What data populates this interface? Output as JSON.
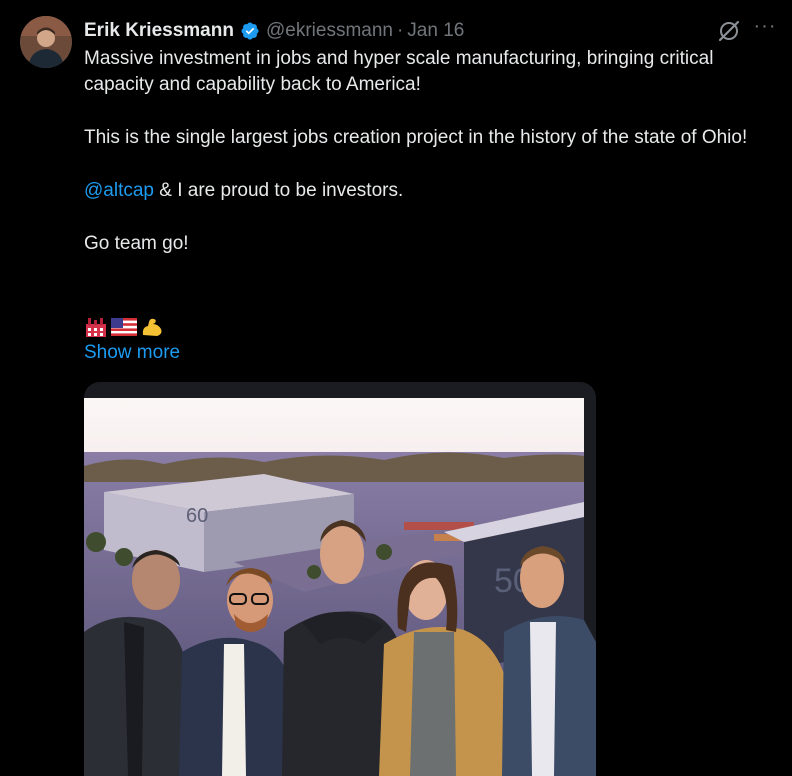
{
  "tweet": {
    "author_name": "Erik Kriessmann",
    "handle": "@ekriessmann",
    "separator": "·",
    "date": "Jan 16",
    "more_label": "···",
    "paragraphs": [
      "Massive investment in jobs and hyper scale manufacturing, bringing critical capacity and capability back to America!",
      "This is the single largest jobs creation project in the history of the state of Ohio!"
    ],
    "mention": "@altcap",
    "mention_rest": " & I are proud to be investors.",
    "go_team": "Go team go!",
    "emojis": [
      "factory-emoji",
      "us-flag-emoji",
      "flexed-biceps-emoji"
    ],
    "show_more": "Show more",
    "accent_color": "#1d9bf0",
    "verified_color": "#1d9bf0"
  },
  "photo": {
    "building_labels": [
      "60",
      "50"
    ]
  }
}
